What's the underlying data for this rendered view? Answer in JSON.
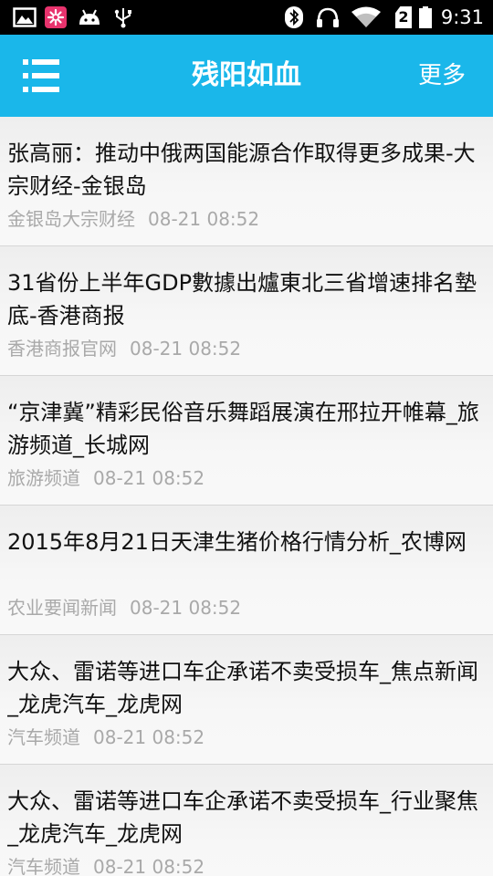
{
  "status_bar": {
    "time": "9:31",
    "left_icons": [
      "image-icon",
      "flower-app-icon",
      "android-icon",
      "usb-icon"
    ],
    "right_icons": [
      "bluetooth-icon",
      "headphones-icon",
      "wifi-icon",
      "sim-card-icon",
      "battery-icon"
    ],
    "sim_label": "2"
  },
  "app_bar": {
    "title": "残阳如血",
    "more_label": "更多",
    "menu_icon": "hamburger-menu-icon",
    "color": "#1ab7ea"
  },
  "news": [
    {
      "title": "张高丽：推动中俄两国能源合作取得更多成果-大宗财经-金银岛",
      "source": "金银岛大宗财经",
      "time": "08-21 08:52"
    },
    {
      "title": "31省份上半年GDP數據出爐東北三省增速排名墊底-香港商报",
      "source": "香港商报官网",
      "time": "08-21 08:52"
    },
    {
      "title": "“京津冀”精彩民俗音乐舞蹈展演在邢拉开帷幕_旅游频道_长城网",
      "source": "旅游频道",
      "time": "08-21 08:52"
    },
    {
      "title": "2015年8月21日天津生猪价格行情分析_农博网",
      "source": "农业要闻新闻",
      "time": "08-21 08:52"
    },
    {
      "title": "大众、雷诺等进口车企承诺不卖受损车_焦点新闻_龙虎汽车_龙虎网",
      "source": "汽车频道",
      "time": "08-21 08:52"
    },
    {
      "title": "大众、雷诺等进口车企承诺不卖受损车_行业聚焦_龙虎汽车_龙虎网",
      "source": "汽车频道",
      "time": "08-21 08:52"
    }
  ]
}
